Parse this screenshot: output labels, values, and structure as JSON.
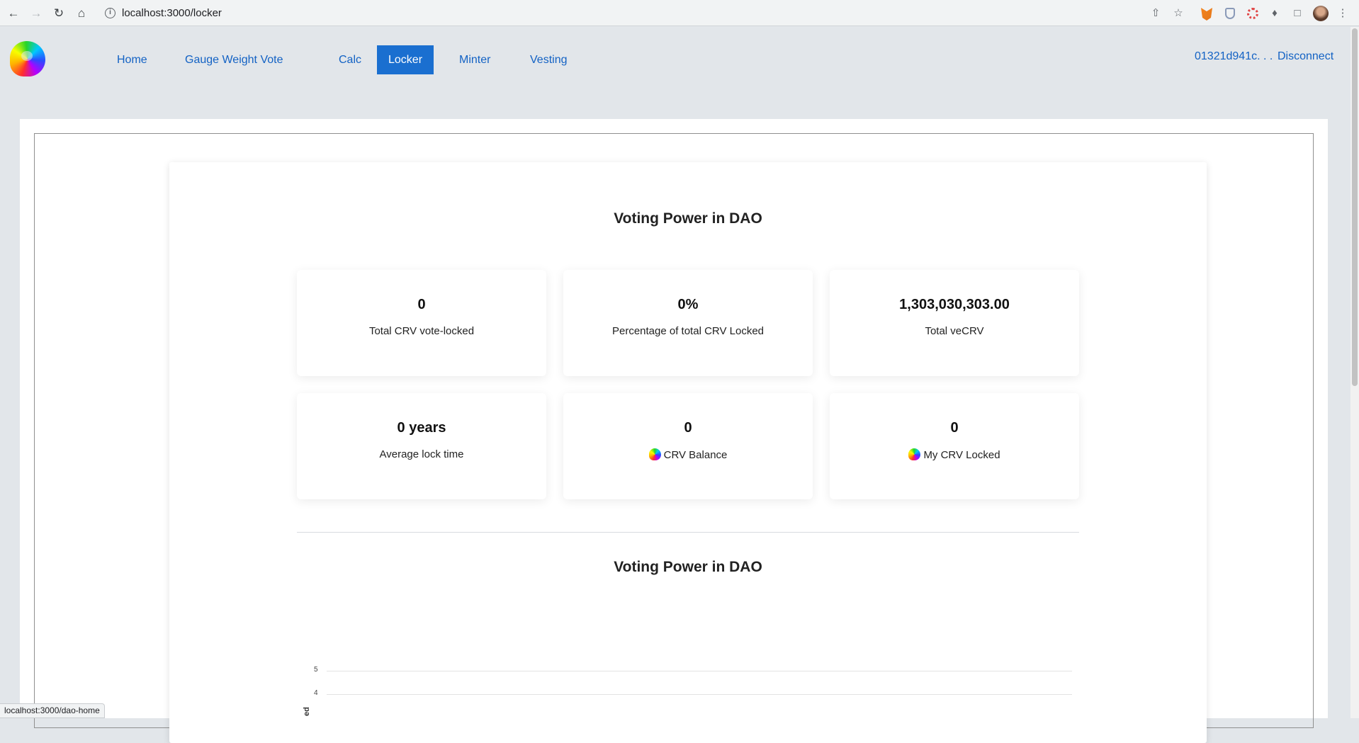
{
  "browser": {
    "url": "localhost:3000/locker",
    "status_url": "localhost:3000/dao-home"
  },
  "nav": {
    "items": [
      {
        "label": "Home"
      },
      {
        "label": "Gauge Weight Vote"
      },
      {
        "label": "Calc"
      },
      {
        "label": "Locker",
        "active": true
      },
      {
        "label": "Minter"
      },
      {
        "label": "Vesting"
      }
    ],
    "account": "01321d941c. . .",
    "disconnect": "Disconnect"
  },
  "main": {
    "title": "Voting Power in DAO",
    "stats": [
      {
        "value": "0",
        "label": "Total CRV vote-locked"
      },
      {
        "value": "0%",
        "label": "Percentage of total CRV Locked"
      },
      {
        "value": "1,303,030,303.00",
        "label": "Total veCRV"
      },
      {
        "value": "0 years",
        "label": "Average lock time"
      },
      {
        "value": "0",
        "label": "CRV Balance",
        "icon": "crv-icon"
      },
      {
        "value": "0",
        "label": "My CRV Locked",
        "icon": "crv-icon"
      }
    ],
    "chart_title": "Voting Power in DAO"
  },
  "chart_data": {
    "type": "line",
    "title": "Voting Power in DAO",
    "y_ticks": [
      "5",
      "4"
    ],
    "ylabel_visible": "ed",
    "series": []
  },
  "colors": {
    "accent": "#1a6fd0",
    "link": "#1362c4",
    "background": "#e2e6ea"
  }
}
